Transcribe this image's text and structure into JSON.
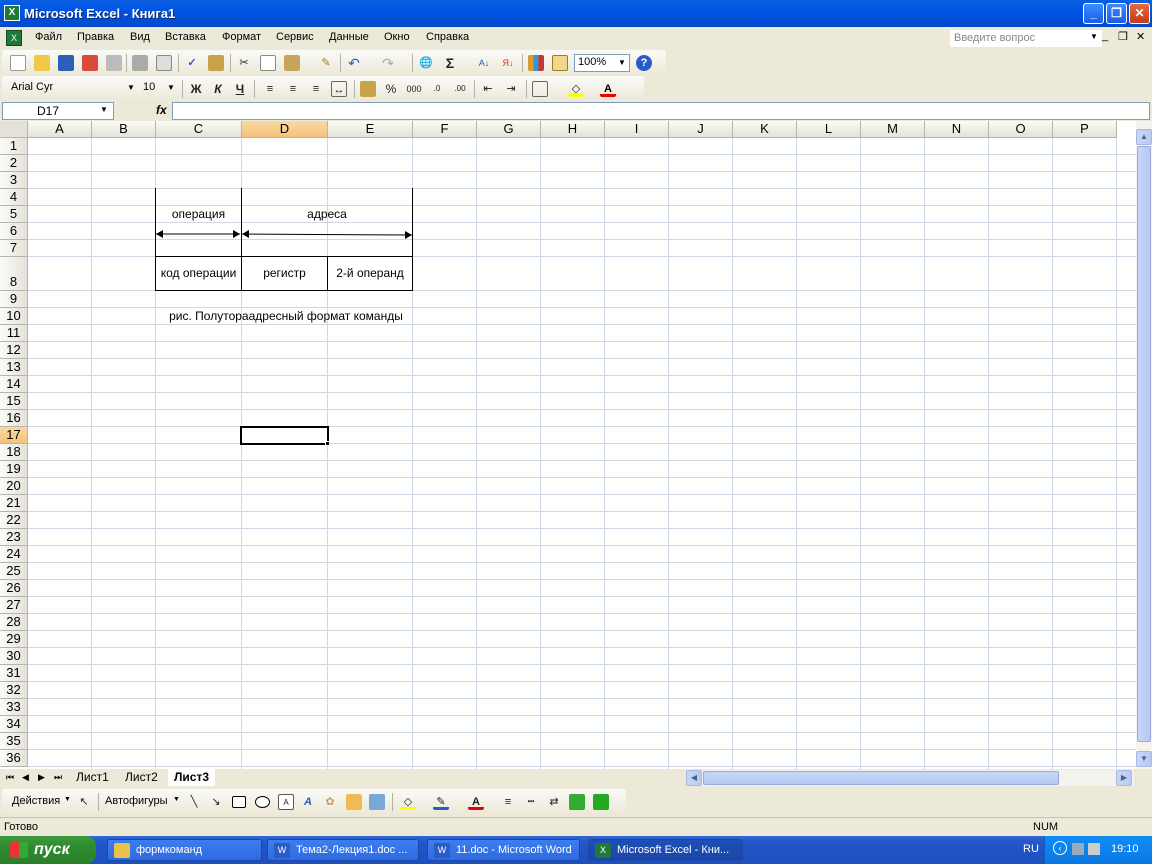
{
  "window": {
    "title": "Microsoft Excel - Книга1"
  },
  "menu": {
    "items": [
      "Файл",
      "Правка",
      "Вид",
      "Вставка",
      "Формат",
      "Сервис",
      "Данные",
      "Окно",
      "Справка"
    ],
    "ask_placeholder": "Введите вопрос"
  },
  "toolbar": {
    "zoom": "100%",
    "font": "Arial Cyr",
    "size": "10",
    "bold": "Ж",
    "italic": "К",
    "underline": "Ч",
    "percent": "%",
    "thousands": "000",
    "sum": "Σ"
  },
  "formula_bar": {
    "name_box": "D17",
    "fx": "fx",
    "value": ""
  },
  "columns": [
    "A",
    "B",
    "C",
    "D",
    "E",
    "F",
    "G",
    "H",
    "I",
    "J",
    "K",
    "L",
    "M",
    "N",
    "O",
    "P"
  ],
  "rows": [
    "1",
    "2",
    "3",
    "4",
    "5",
    "6",
    "7",
    "8",
    "9",
    "10",
    "11",
    "12",
    "13",
    "14",
    "15",
    "16",
    "17",
    "18",
    "19",
    "20",
    "21",
    "22",
    "23",
    "24",
    "25",
    "26",
    "27",
    "28",
    "29",
    "30",
    "31",
    "32",
    "33",
    "34",
    "35",
    "36"
  ],
  "selected": {
    "column": "D",
    "row": "17"
  },
  "cells": {
    "operation": "операция",
    "addresses": "адреса",
    "opcode": "код операции",
    "register": "регистр",
    "operand2": "2-й операнд",
    "caption": "рис. Полутораадресный формат команды"
  },
  "sheets": {
    "tabs": [
      "Лист1",
      "Лист2",
      "Лист3"
    ],
    "active": "Лист3"
  },
  "drawing": {
    "actions": "Действия",
    "autoshapes": "Автофигуры"
  },
  "status": {
    "left": "Готово",
    "num": "NUM"
  },
  "taskbar": {
    "start": "пуск",
    "tasks": [
      "формкоманд",
      "Тема2-Лекция1.doc ...",
      "11.doc - Microsoft Word",
      "Microsoft Excel - Кни..."
    ],
    "lang": "RU",
    "clock": "19:10"
  },
  "colors": {
    "title_bar": "#0055e5",
    "selection_header": "#f4c27a",
    "taskbar": "#245edb",
    "start": "#2e8b2e"
  }
}
